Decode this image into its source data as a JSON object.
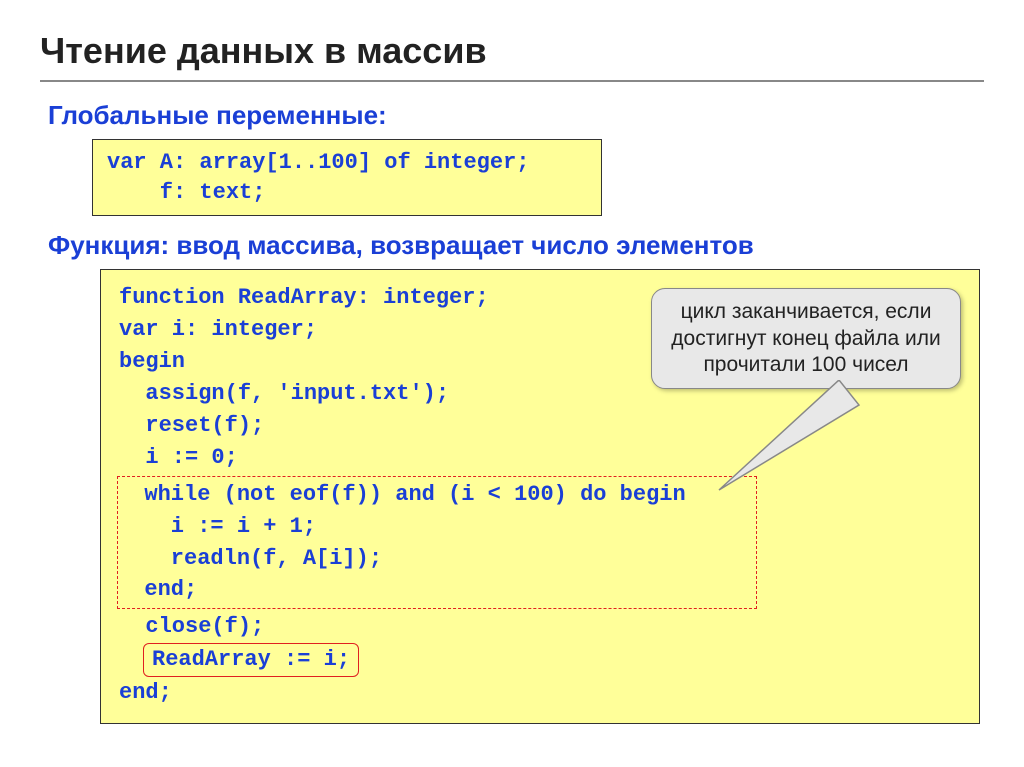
{
  "title": "Чтение данных в массив",
  "sub1": "Глобальные переменные:",
  "code1": "var A: array[1..100] of integer;\n    f: text;",
  "sub2": "Функция: ввод массива, возвращает число элементов",
  "func": {
    "l1": "function ReadArray: integer;",
    "l2": "var i: integer;",
    "l3": "begin",
    "l4": "  assign(f, 'input.txt');",
    "l5": "  reset(f);",
    "l6": "  i := 0;",
    "d1": "  while (not eof(f)) and (i < 100) do begin",
    "d2": "    i := i + 1;",
    "d3": "    readln(f, A[i]);",
    "d4": "  end;",
    "l7": "  close(f);",
    "r1": "ReadArray := i;",
    "l8": "end;"
  },
  "callout": "цикл заканчивается, если достигнут конец файла или прочитали 100 чисел"
}
